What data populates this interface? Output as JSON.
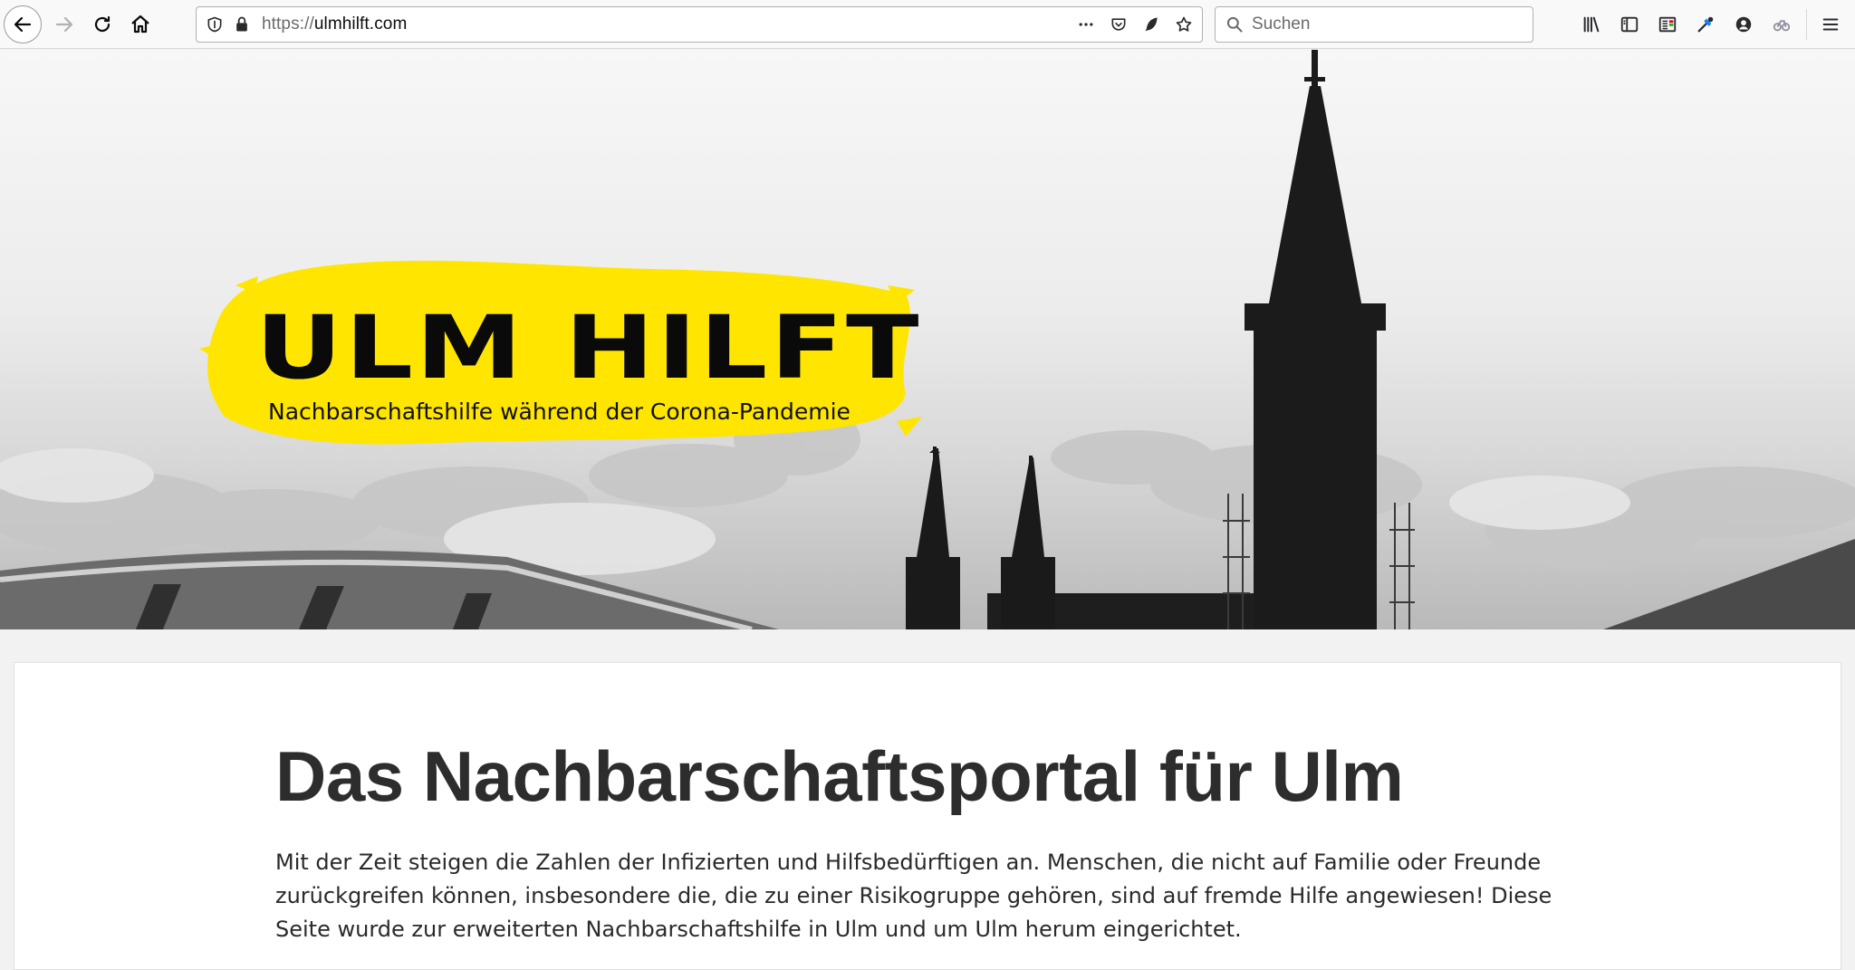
{
  "browser": {
    "url_scheme": "https://",
    "url_host": "ulmhilft.com",
    "search_placeholder": "Suchen"
  },
  "hero": {
    "logo_title": "ULM HILFT",
    "logo_subtitle": "Nachbarschaftshilfe während der Corona-Pandemie",
    "brand_color": "#ffe500"
  },
  "content": {
    "title": "Das Nachbarschaftsportal für Ulm",
    "intro": "Mit der Zeit steigen die Zahlen der Infizierten und Hilfsbedürftigen an. Menschen, die nicht auf Familie oder Freunde zurückgreifen können, insbesondere die, die zu einer Risikogruppe gehören, sind auf fremde Hilfe angewiesen! Diese Seite wurde zur erweiterten Nachbarschaftshilfe in Ulm und um Ulm herum eingerichtet."
  },
  "icons": [
    "back-arrow-icon",
    "forward-arrow-icon",
    "reload-icon",
    "home-icon",
    "shield-icon",
    "lock-icon",
    "more-icon",
    "pocket-icon",
    "feather-icon",
    "star-icon",
    "search-icon",
    "library-icon",
    "sidebar-icon",
    "reader-icon",
    "eyedropper-icon",
    "account-icon",
    "sync-icon",
    "hamburger-menu-icon"
  ]
}
